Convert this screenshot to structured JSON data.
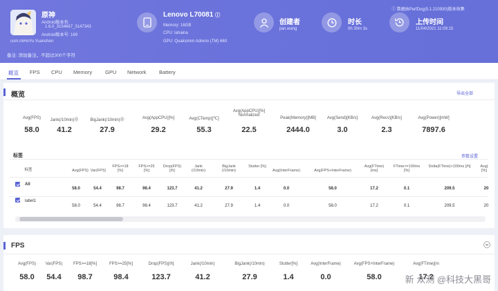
{
  "header": {
    "app_name": "原神",
    "app_lines": [
      "Android版本名:",
      "1.6.0_3154667_3147343",
      "Android版本号: 169",
      "com.miHoYo.Yuanshen"
    ],
    "remark": "备注: 添加备注，不超过300个字符",
    "device": {
      "title": "Lenovo L70081",
      "memory": "Memory: 16GB",
      "cpu": "CPU: Iahaina",
      "gpu": "GPU: Qualcomm Adreno (TM) 660"
    },
    "creator": {
      "title": "创建者",
      "value": "jian.wang"
    },
    "duration": {
      "title": "时长",
      "value": "0h 30m 3s"
    },
    "upload": {
      "title": "上传时间",
      "value": "11/04/2021 11:09:15",
      "note": "数据由PerfDog(5.1.210930)版本收集"
    }
  },
  "tabs": [
    "概览",
    "FPS",
    "CPU",
    "Memory",
    "GPU",
    "Network",
    "Battery"
  ],
  "overview": {
    "title": "概览",
    "export_label": "导出全部",
    "metrics": [
      {
        "label": "Avg(FPS)",
        "value": "58.0"
      },
      {
        "label": "Jank(/10min)⓪",
        "value": "41.2"
      },
      {
        "label": "BigJank(/10min)⓪",
        "value": "27.9"
      },
      {
        "label": "Avg(AppCPU)[%]",
        "value": "29.2"
      },
      {
        "label": "Avg(CTemp)[℃]",
        "value": "55.3"
      },
      {
        "label": "Avg(AppCPU)[%] Normalized",
        "value": "22.5"
      },
      {
        "label": "Peak(Memory)[MB]",
        "value": "2444.0"
      },
      {
        "label": "Avg(Send)[KB/s]",
        "value": "3.0"
      },
      {
        "label": "Avg(Recv)[KB/s]",
        "value": "2.3"
      },
      {
        "label": "Avg(Power)[mW]",
        "value": "7897.6"
      }
    ]
  },
  "labels_table": {
    "title": "标签",
    "settings_label": "参数设置",
    "headers": [
      "标签",
      "Avg(FPS)",
      "Var(FPS)",
      "FPS>=18 [%]",
      "FPS>=25 [%]",
      "Drop(FPS) [/h]",
      "Jank (/10min)",
      "BigJank (/10min)",
      "Stutter [%]",
      "Avg(InterFrame)",
      "Avg(FPS+InterFrame)",
      "Avg(FTime) [ms]",
      "FTime>=100ms [%]",
      "Delta(FTime)>100ms [/h]",
      "Avg( [%]"
    ],
    "rows": [
      {
        "label": "All",
        "values": [
          "58.0",
          "54.4",
          "98.7",
          "98.4",
          "123.7",
          "41.2",
          "27.9",
          "1.4",
          "0.0",
          "58.0",
          "17.2",
          "0.1",
          "209.5",
          "20"
        ]
      },
      {
        "label": "label1",
        "values": [
          "58.0",
          "54.4",
          "98.7",
          "98.4",
          "123.7",
          "41.2",
          "27.9",
          "1.4",
          "0.0",
          "58.0",
          "17.2",
          "0.1",
          "209.5",
          "20"
        ]
      }
    ]
  },
  "fps": {
    "title": "FPS",
    "headers": [
      "Avg(FPS)",
      "Var(FPS)",
      "FPS>=18[%]",
      "FPS>=25[%]",
      "Drop(FPS)[/h]",
      "Jank(/10min)",
      "BigJank(/10min)",
      "Stutter[%]",
      "Avg(InterFrame)",
      "Avg(FPS+InterFrame)",
      "Avg(FTime)[m"
    ],
    "values": [
      "58.0",
      "54.4",
      "98.7",
      "98.4",
      "123.7",
      "41.2",
      "27.9",
      "1.4",
      "0.0",
      "58.0",
      "17.2"
    ]
  },
  "watermark": "新 众测 @科技大黑哥"
}
